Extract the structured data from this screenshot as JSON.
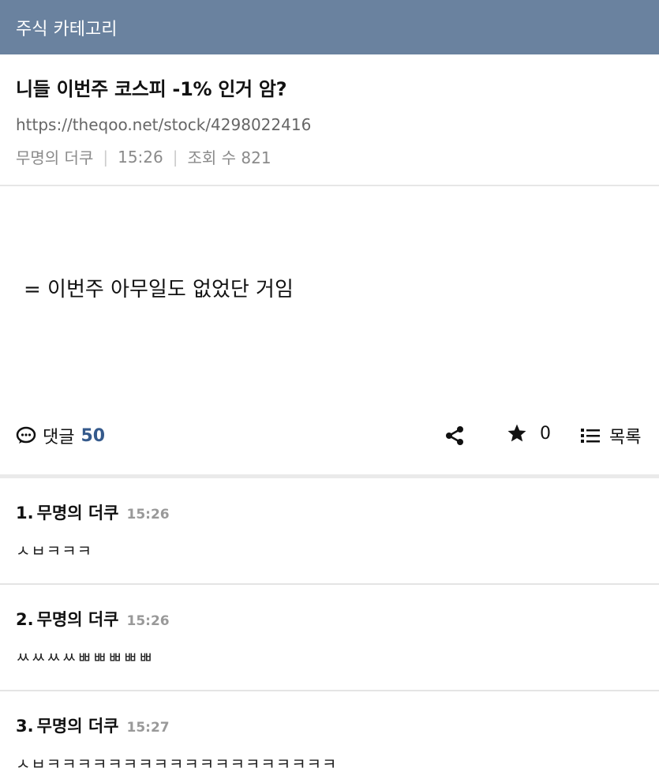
{
  "category": "주식 카테고리",
  "post": {
    "title": "니들 이번주 코스피 -1% 인거 암?",
    "url": "https://theqoo.net/stock/4298022416",
    "author": "무명의 더쿠",
    "time": "15:26",
    "views": "조회 수 821",
    "body": "= 이번주 아무일도 없었단 거임"
  },
  "actions": {
    "comments_label": "댓글",
    "comments_count": "50",
    "star_count": "0",
    "list_label": "목록",
    "icons": [
      "comment-icon",
      "share-icon",
      "star-icon",
      "list-icon"
    ]
  },
  "comments": [
    {
      "num": "1.",
      "author": "무명의 더쿠",
      "time": "15:26",
      "text": "ㅅㅂㅋㅋㅋ"
    },
    {
      "num": "2.",
      "author": "무명의 더쿠",
      "time": "15:26",
      "text": "ㅆㅆㅆㅆㅃㅃㅃㅃㅃ"
    },
    {
      "num": "3.",
      "author": "무명의 더쿠",
      "time": "15:27",
      "text": "ㅅㅂㅋㅋㅋㅋㅋㅋㅋㅋㅋㅋㅋㅋㅋㅋㅋㅋㅋㅋㅋ"
    }
  ],
  "colors": {
    "header_bg": "#6a829f",
    "accent": "#355a8c"
  }
}
